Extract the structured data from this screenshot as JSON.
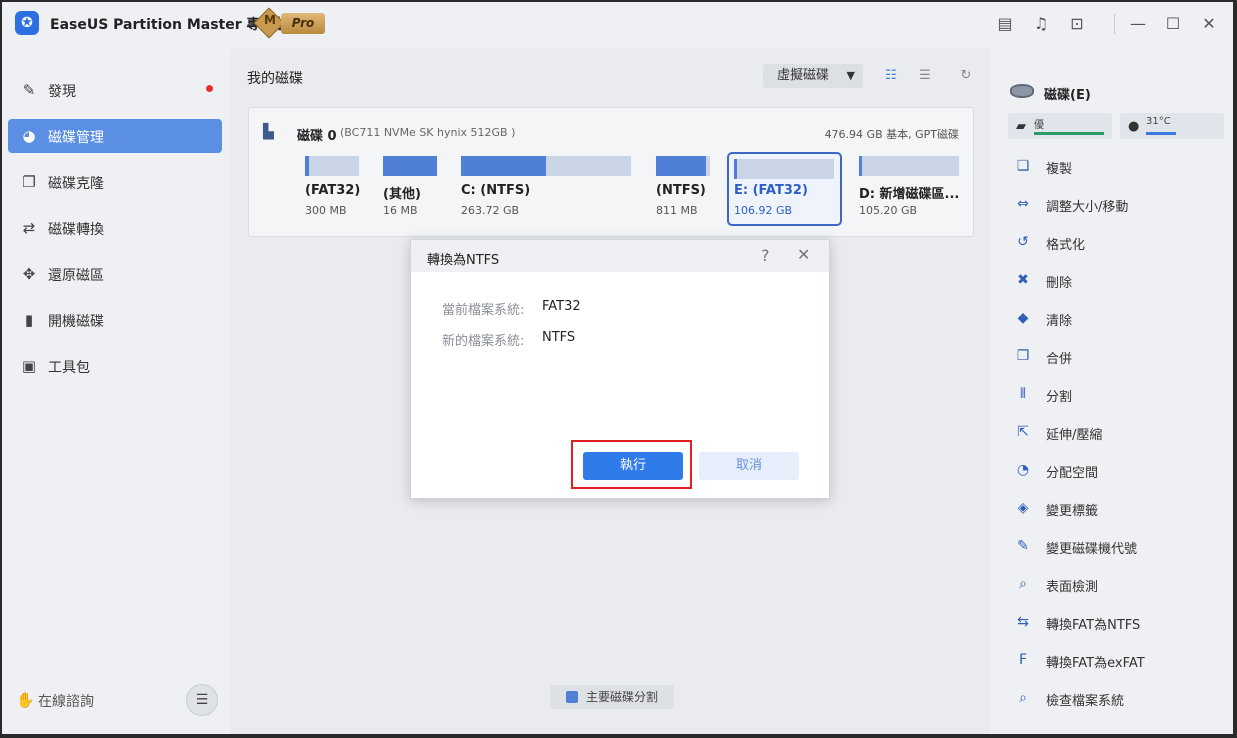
{
  "app": {
    "logo_glyph": "✪",
    "title": "EaseUS Partition Master 專業版",
    "edition_badge_letter": "M",
    "edition_label": "Pro"
  },
  "titlebar_icons": [
    "notes-icon",
    "bell-icon",
    "download-icon",
    "minimize-icon",
    "maximize-icon",
    "close-icon"
  ],
  "sidebar": {
    "items": [
      {
        "label": "發現",
        "icon": "discover-icon",
        "glyph": "✎",
        "active": false,
        "has_dot": true
      },
      {
        "label": "磁碟管理",
        "icon": "disk-management-icon",
        "glyph": "◕",
        "active": true,
        "has_dot": false
      },
      {
        "label": "磁碟克隆",
        "icon": "disk-clone-icon",
        "glyph": "❐",
        "active": false,
        "has_dot": false
      },
      {
        "label": "磁碟轉換",
        "icon": "disk-convert-icon",
        "glyph": "⇄",
        "active": false,
        "has_dot": false
      },
      {
        "label": "還原磁區",
        "icon": "recover-partition-icon",
        "glyph": "✥",
        "active": false,
        "has_dot": false
      },
      {
        "label": "開機磁碟",
        "icon": "bootable-disk-icon",
        "glyph": "▮",
        "active": false,
        "has_dot": false
      },
      {
        "label": "工具包",
        "icon": "toolkit-icon",
        "glyph": "▣",
        "active": false,
        "has_dot": false
      }
    ],
    "consult_label": "在線諮詢",
    "consult_glyph": "✋",
    "chat_glyph": "☰"
  },
  "main": {
    "title": "我的磁碟",
    "virtual_disk_label": "虛擬磁碟",
    "disk": {
      "name": "磁碟 0",
      "model": "(BC711 NVMe SK hynix 512GB )",
      "info": "476.94 GB 基本, GPT磁碟",
      "partitions": [
        {
          "name": "(FAT32)",
          "size": "300 MB",
          "used_fraction": 0.08,
          "selected": false
        },
        {
          "name": "(其他)",
          "size": "16 MB",
          "used_fraction": 1.0,
          "selected": false
        },
        {
          "name": "C: (NTFS)",
          "size": "263.72 GB",
          "used_fraction": 0.5,
          "selected": false
        },
        {
          "name": "(NTFS)",
          "size": "811 MB",
          "used_fraction": 0.92,
          "selected": false
        },
        {
          "name": "E: (FAT32)",
          "size": "106.92 GB",
          "used_fraction": 0.02,
          "selected": true
        },
        {
          "name": "D: 新增磁碟區...",
          "size": "105.20 GB",
          "used_fraction": 0.02,
          "selected": false
        }
      ]
    },
    "legend_label": "主要磁碟分割"
  },
  "right_panel": {
    "disk_label": "磁碟(E)",
    "health_label": "優",
    "temperature_label": "31°C",
    "actions": [
      {
        "label": "複製",
        "icon": "copy-icon",
        "glyph": "❏"
      },
      {
        "label": "調整大小/移動",
        "icon": "resize-move-icon",
        "glyph": "⇔"
      },
      {
        "label": "格式化",
        "icon": "format-icon",
        "glyph": "↺"
      },
      {
        "label": "刪除",
        "icon": "delete-icon",
        "glyph": "✖"
      },
      {
        "label": "清除",
        "icon": "wipe-icon",
        "glyph": "◆"
      },
      {
        "label": "合併",
        "icon": "merge-icon",
        "glyph": "❐"
      },
      {
        "label": "分割",
        "icon": "split-icon",
        "glyph": "⫴"
      },
      {
        "label": "延伸/壓縮",
        "icon": "extend-shrink-icon",
        "glyph": "⇱"
      },
      {
        "label": "分配空間",
        "icon": "allocate-space-icon",
        "glyph": "◔"
      },
      {
        "label": "變更標籤",
        "icon": "change-label-icon",
        "glyph": "◈"
      },
      {
        "label": "變更磁碟機代號",
        "icon": "change-drive-letter-icon",
        "glyph": "✎"
      },
      {
        "label": "表面檢測",
        "icon": "surface-test-icon",
        "glyph": "⌕"
      },
      {
        "label": "轉換FAT為NTFS",
        "icon": "convert-fat-ntfs-icon",
        "glyph": "⇆"
      },
      {
        "label": "轉換FAT為exFAT",
        "icon": "convert-fat-exfat-icon",
        "glyph": "F"
      },
      {
        "label": "檢查檔案系統",
        "icon": "check-filesystem-icon",
        "glyph": "⌕"
      }
    ]
  },
  "dialog": {
    "title": "轉換為NTFS",
    "current_fs_label": "當前檔案系統:",
    "current_fs_value": "FAT32",
    "new_fs_label": "新的檔案系統:",
    "new_fs_value": "NTFS",
    "run_label": "執行",
    "cancel_label": "取消"
  },
  "colors": {
    "accent": "#2f7bea",
    "sidebar_active": "#5b8fe3",
    "partition_fill": "#4f7fd6",
    "highlight": "#e02020"
  }
}
